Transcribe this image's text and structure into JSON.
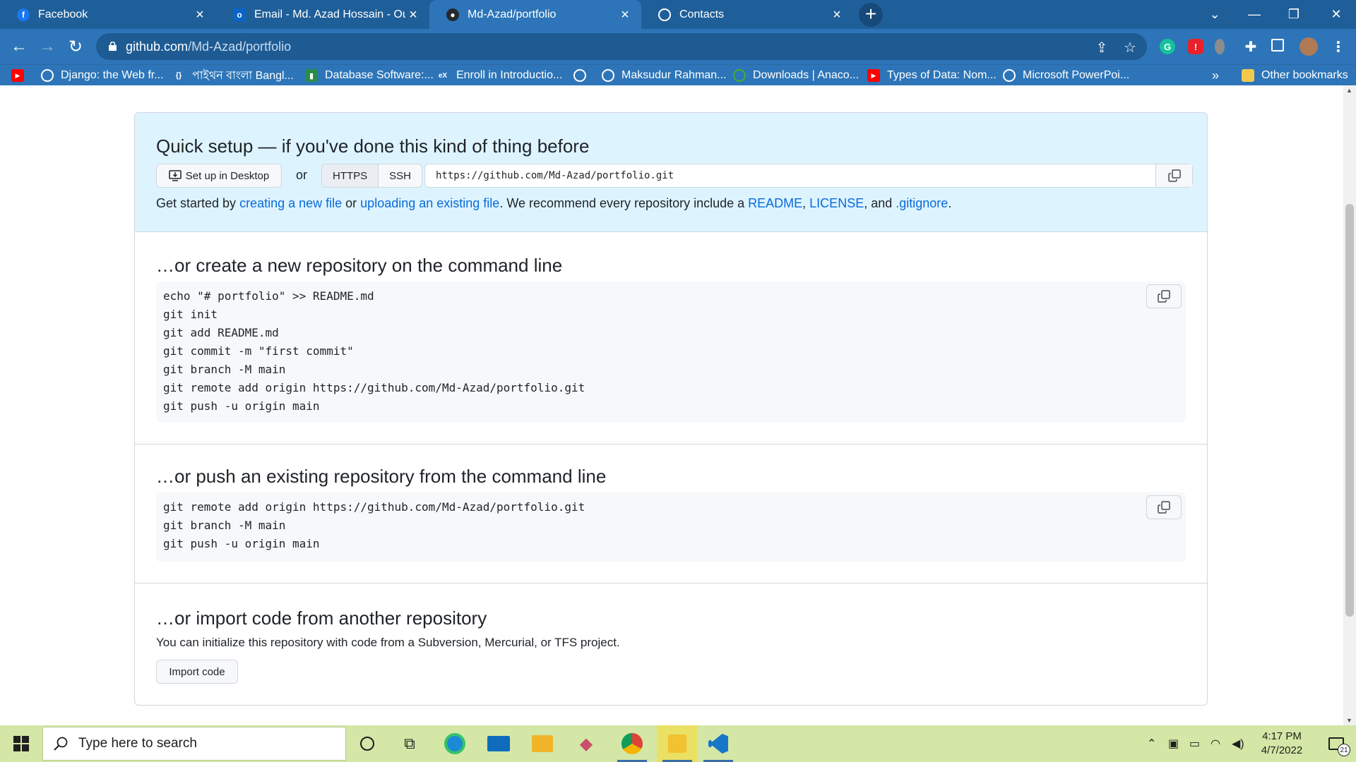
{
  "browser": {
    "tabs": [
      {
        "title": "Facebook",
        "icon": "facebook-icon"
      },
      {
        "title": "Email - Md. Azad Hossain - Outlo",
        "icon": "outlook-icon"
      },
      {
        "title": "Md-Azad/portfolio",
        "icon": "github-icon"
      },
      {
        "title": "Contacts",
        "icon": "globe-icon"
      }
    ],
    "address": {
      "host": "github.com",
      "path": "/Md-Azad/portfolio"
    },
    "bookmarks": [
      {
        "label": "",
        "icon": "youtube-icon"
      },
      {
        "label": "Django: the Web fr...",
        "icon": "globe-icon"
      },
      {
        "label": "পাইথন বাংলা Bangl...",
        "icon": "code-icon"
      },
      {
        "label": "Database Software:...",
        "icon": "database-icon"
      },
      {
        "label": "Enroll in Introductio...",
        "icon": "edx-icon"
      },
      {
        "label": "",
        "icon": "globe-icon"
      },
      {
        "label": "Maksudur Rahman...",
        "icon": "globe-icon"
      },
      {
        "label": "Downloads | Anaco...",
        "icon": "anaconda-icon"
      },
      {
        "label": "Types of Data: Nom...",
        "icon": "youtube-icon"
      },
      {
        "label": "Microsoft PowerPoi...",
        "icon": "globe-icon"
      }
    ],
    "bookmarks_more": "»",
    "other_bookmarks": "Other bookmarks"
  },
  "quick_setup": {
    "title": "Quick setup — if you've done this kind of thing before",
    "desktop_button": "Set up in Desktop",
    "or": "or",
    "https": "HTTPS",
    "ssh": "SSH",
    "clone_url": "https://github.com/Md-Azad/portfolio.git",
    "get_started": {
      "t1": "Get started by ",
      "l1": "creating a new file",
      "t2": " or ",
      "l2": "uploading an existing file",
      "t3": ". We recommend every repository include a ",
      "l3": "README",
      "t4": ", ",
      "l4": "LICENSE",
      "t5": ", and ",
      "l5": ".gitignore",
      "t6": "."
    }
  },
  "new_repo": {
    "title": "…or create a new repository on the command line",
    "code": "echo \"# portfolio\" >> README.md\ngit init\ngit add README.md\ngit commit -m \"first commit\"\ngit branch -M main\ngit remote add origin https://github.com/Md-Azad/portfolio.git\ngit push -u origin main"
  },
  "push_repo": {
    "title": "…or push an existing repository from the command line",
    "code": "git remote add origin https://github.com/Md-Azad/portfolio.git\ngit branch -M main\ngit push -u origin main"
  },
  "import_repo": {
    "title": "…or import code from another repository",
    "text": "You can initialize this repository with code from a Subversion, Mercurial, or TFS project.",
    "button": "Import code"
  },
  "taskbar": {
    "search_placeholder": "Type here to search",
    "time": "4:17 PM",
    "date": "4/7/2022",
    "notifications": "21"
  }
}
